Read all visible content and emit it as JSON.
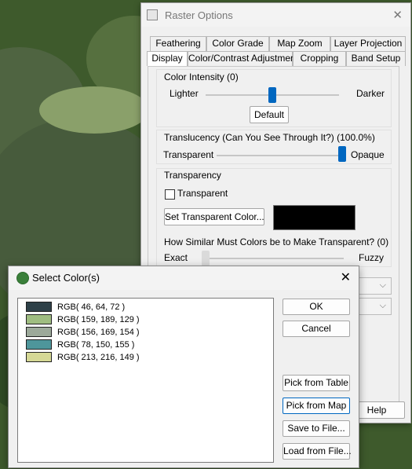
{
  "raster_options": {
    "title": "Raster Options",
    "close": "✕",
    "tabs_row1": [
      "Feathering",
      "Color Grade",
      "Map Zoom",
      "Layer Projection"
    ],
    "tabs_row2": [
      "Display",
      "Color/Contrast Adjustment",
      "Cropping",
      "Band Setup"
    ],
    "active_tab": "Display",
    "color_intensity": {
      "label": "Color Intensity (0)",
      "left": "Lighter",
      "right": "Darker",
      "value_fraction": 0.5,
      "default_button": "Default"
    },
    "translucency": {
      "label": "Translucency (Can You See Through It?) (100.0%)",
      "left": "Transparent",
      "right": "Opaque",
      "value_fraction": 1.0
    },
    "transparency": {
      "label": "Transparency",
      "checkbox_label": "Transparent",
      "checked": false,
      "set_button": "Set Transparent Color...",
      "swatch_color": "#000000",
      "similar_label": "How Similar Must Colors be to Make Transparent? (0)",
      "left": "Exact",
      "right": "Fuzzy",
      "value_fraction": 0.0
    },
    "help_button": "Help"
  },
  "select_colors": {
    "title": "Select Color(s)",
    "close": "✕",
    "colors": [
      {
        "label": "RGB( 46, 64, 72 )",
        "hex": "#2e4048"
      },
      {
        "label": "RGB( 159, 189, 129 )",
        "hex": "#9fbd81"
      },
      {
        "label": "RGB( 156, 169, 154 )",
        "hex": "#9ca99a"
      },
      {
        "label": "RGB( 78, 150, 155 )",
        "hex": "#4e969b"
      },
      {
        "label": "RGB( 213, 216, 149 )",
        "hex": "#d5d895"
      }
    ],
    "buttons": {
      "ok": "OK",
      "cancel": "Cancel",
      "pick_table": "Pick from Table",
      "pick_map": "Pick from Map",
      "save": "Save to File...",
      "load": "Load from File..."
    }
  }
}
